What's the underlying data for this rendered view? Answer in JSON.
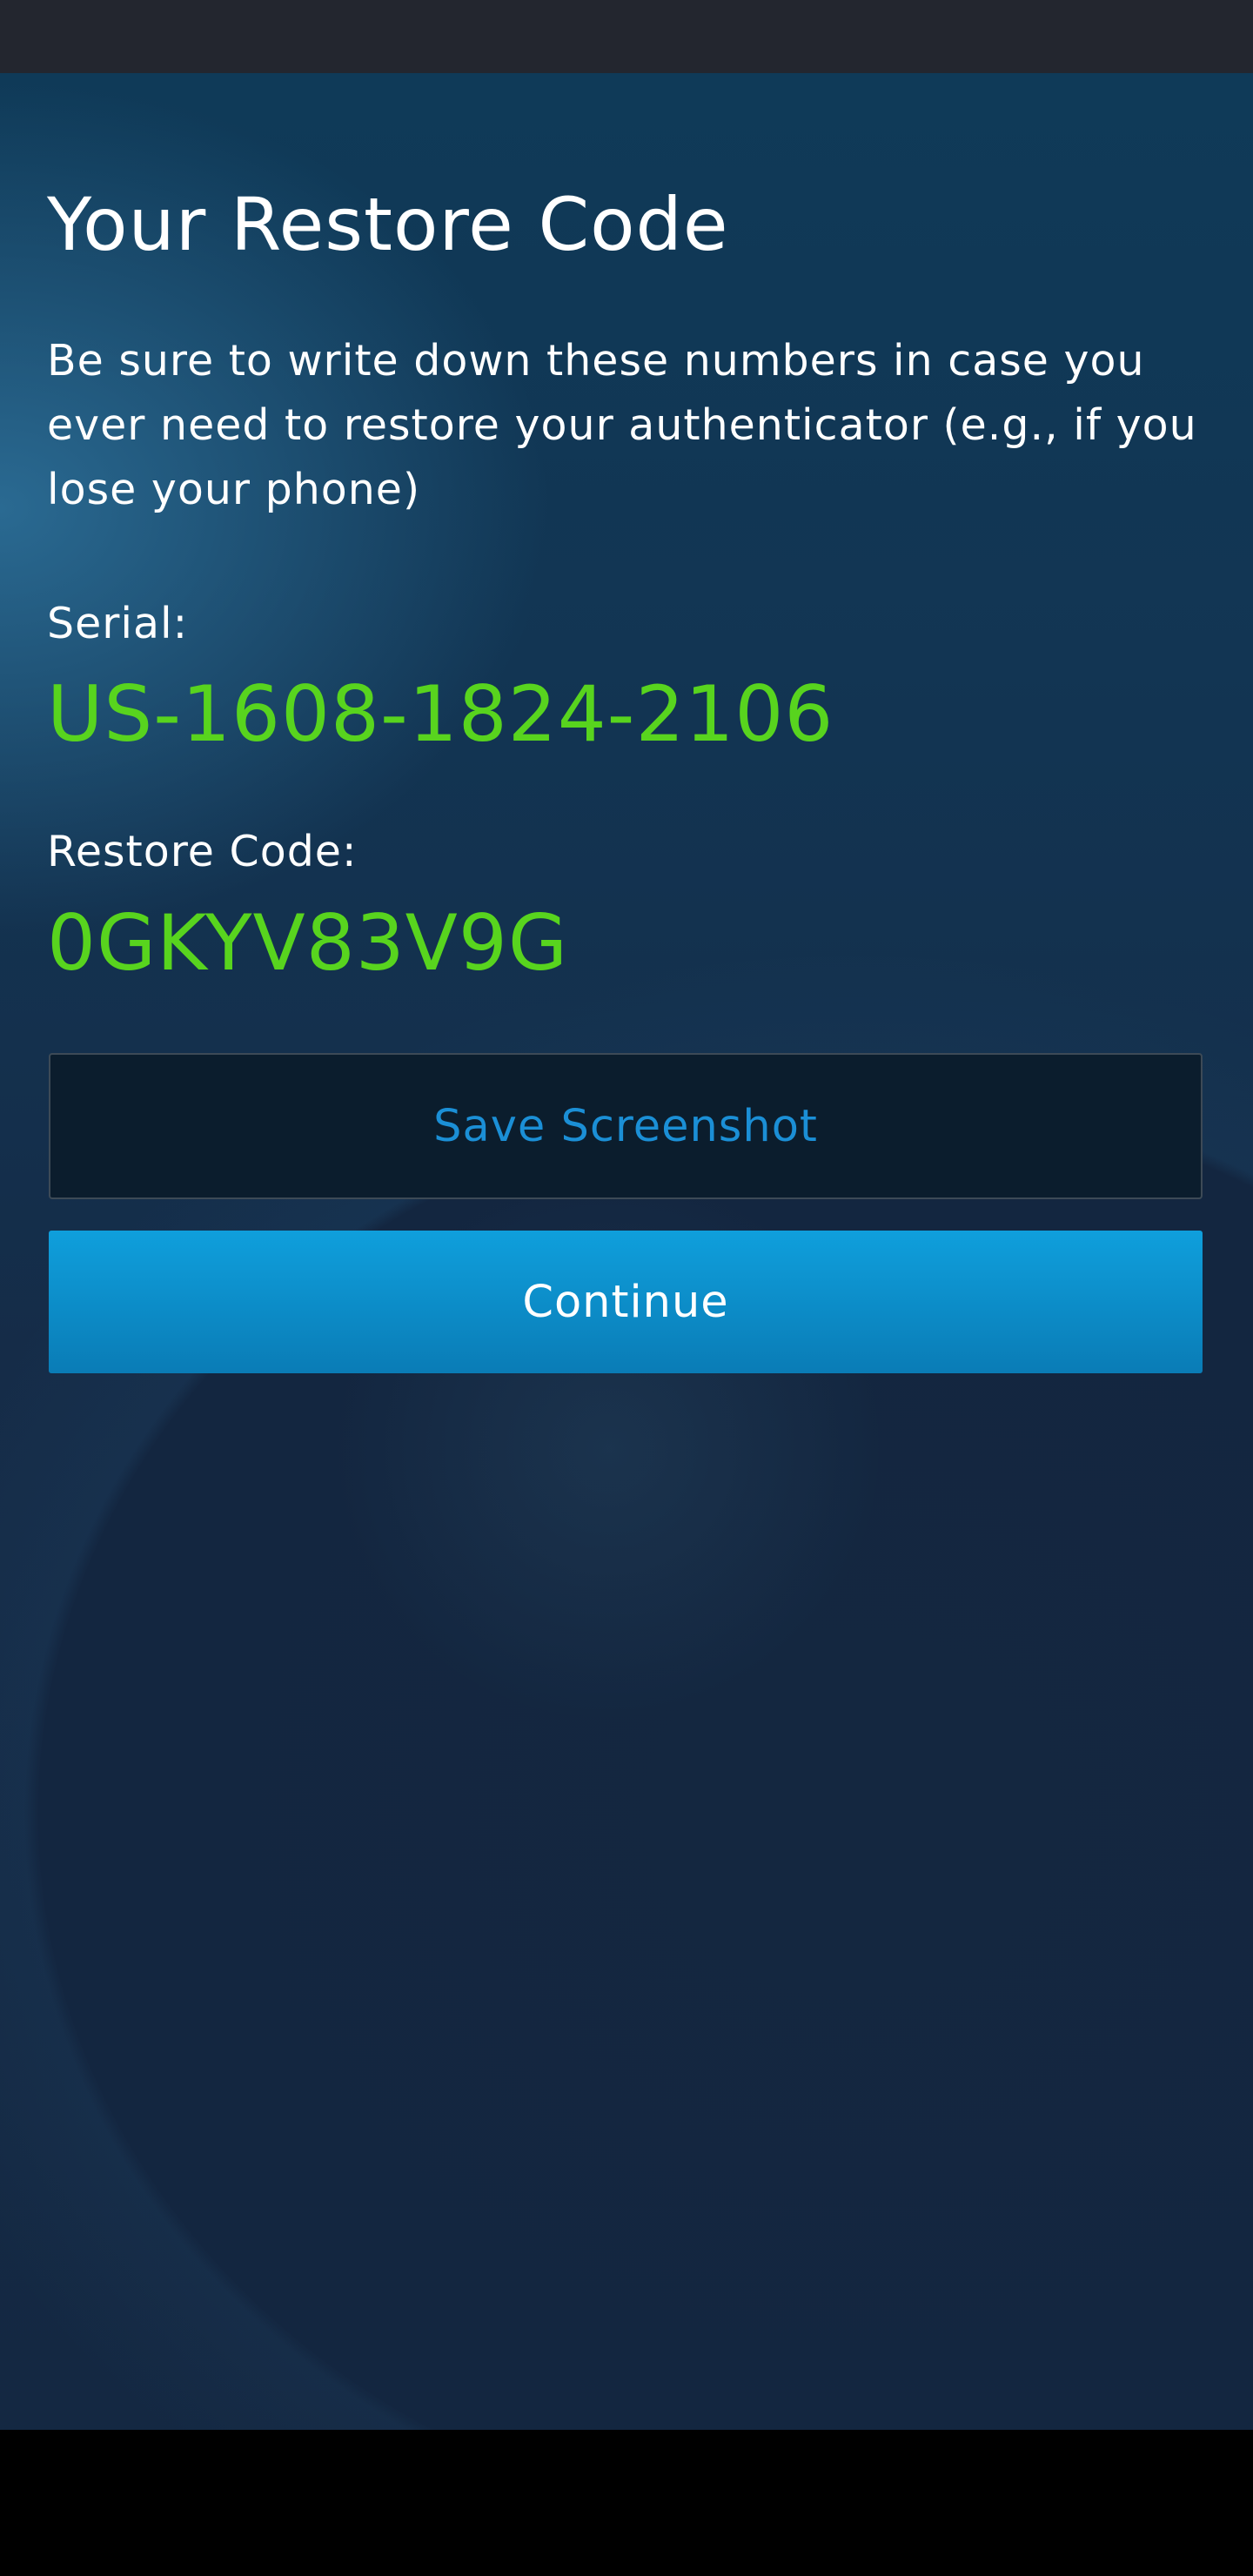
{
  "screen": {
    "title": "Your Restore Code",
    "description": "Be sure to write down these numbers in case you ever need to restore your authenticator (e.g., if you lose your phone)",
    "serial": {
      "label": "Serial:",
      "value": "US-1608-1824-2106"
    },
    "restore_code": {
      "label": "Restore Code:",
      "value": "0GKYV83V9G"
    },
    "buttons": {
      "save_screenshot": "Save Screenshot",
      "continue": "Continue"
    }
  },
  "colors": {
    "value_green": "#58d41e",
    "button_blue": "#0f9fdc",
    "link_blue": "#1b8fd6"
  }
}
